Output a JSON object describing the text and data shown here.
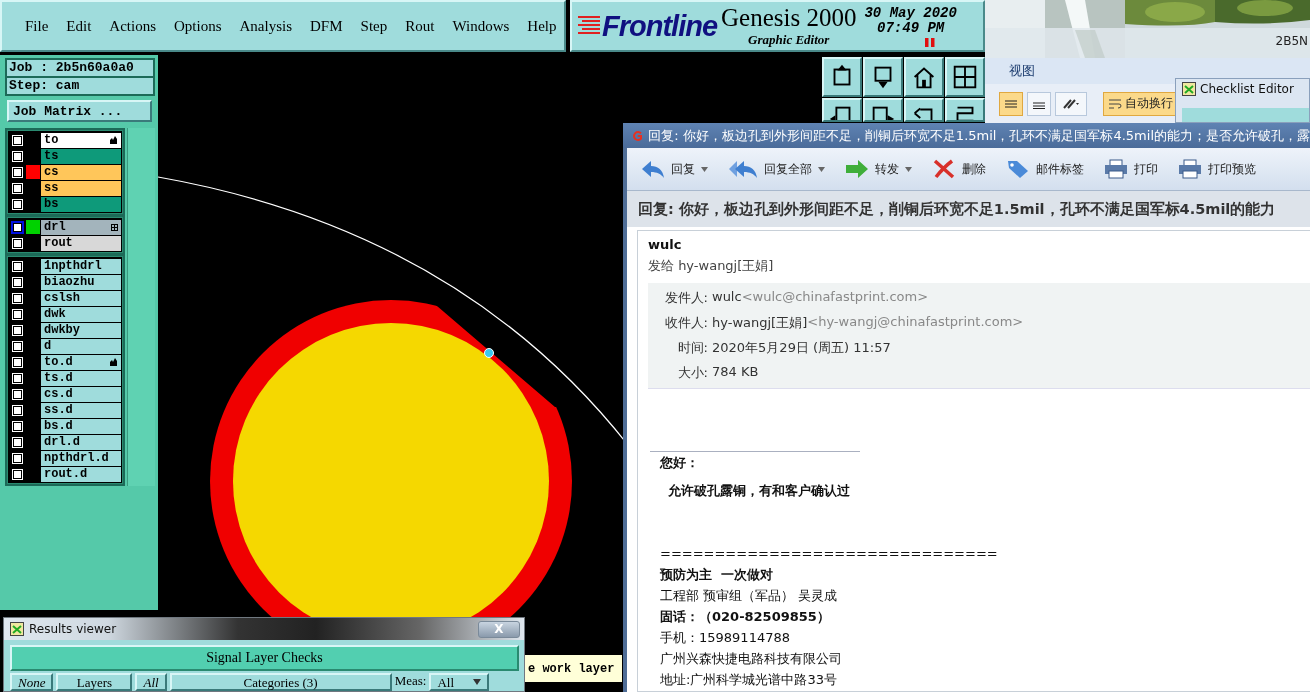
{
  "genesis": {
    "menu": [
      "File",
      "Edit",
      "Actions",
      "Options",
      "Analysis",
      "DFM",
      "Step",
      "Rout",
      "Windows",
      "Help"
    ],
    "logo": {
      "brand": "Frontline",
      "product": "Genesis 2000",
      "subtitle": "Graphic Editor",
      "date": "30 May 2020",
      "time": "07:49 PM"
    },
    "job": "Job : 2b5n60a0a0",
    "step": "Step: cam",
    "job_matrix": "Job Matrix ...",
    "layer_groups": [
      [
        {
          "name": "to",
          "color": "#ffffff",
          "checked": false,
          "selected": false,
          "flag": true
        },
        {
          "name": "ts",
          "color": "#0e9a7a",
          "checked": false,
          "selected": false,
          "flag": false
        },
        {
          "name": "cs",
          "color": "#ffc65a",
          "display": {
            "color": "#ff0000"
          },
          "checked": false,
          "selected": false,
          "flag": false
        },
        {
          "name": "ss",
          "color": "#ffc65a",
          "checked": false,
          "selected": false,
          "flag": false
        },
        {
          "name": "bs",
          "color": "#0e9a7a",
          "checked": false,
          "selected": false,
          "flag": false
        }
      ],
      [
        {
          "name": "drl",
          "color": "#a3b4bc",
          "display": {
            "color": "#00d200"
          },
          "checked": false,
          "selected": true,
          "flag": false
        },
        {
          "name": "rout",
          "color": "#d8d8d8",
          "checked": false,
          "selected": false,
          "flag": false
        }
      ],
      [
        {
          "name": "1npthdrl",
          "color": "#9fdcdc",
          "checked": false,
          "selected": false,
          "flag": false
        },
        {
          "name": "biaozhu",
          "color": "#9fdcdc",
          "checked": false,
          "selected": false,
          "flag": false
        },
        {
          "name": "cslsh",
          "color": "#9fdcdc",
          "checked": false,
          "selected": false,
          "flag": false
        },
        {
          "name": "dwk",
          "color": "#9fdcdc",
          "checked": false,
          "selected": false,
          "flag": false
        },
        {
          "name": "dwkby",
          "color": "#9fdcdc",
          "checked": false,
          "selected": false,
          "flag": false
        },
        {
          "name": "d",
          "color": "#9fdcdc",
          "checked": false,
          "selected": false,
          "flag": false
        },
        {
          "name": "to.d",
          "color": "#9fdcdc",
          "checked": false,
          "selected": false,
          "flag": true
        },
        {
          "name": "ts.d",
          "color": "#9fdcdc",
          "checked": false,
          "selected": false,
          "flag": false
        },
        {
          "name": "cs.d",
          "color": "#9fdcdc",
          "checked": false,
          "selected": false,
          "flag": false
        },
        {
          "name": "ss.d",
          "color": "#9fdcdc",
          "checked": false,
          "selected": false,
          "flag": false
        },
        {
          "name": "bs.d",
          "color": "#9fdcdc",
          "checked": false,
          "selected": false,
          "flag": false
        },
        {
          "name": "drl.d",
          "color": "#9fdcdc",
          "checked": false,
          "selected": false,
          "flag": false
        },
        {
          "name": "npthdrl.d",
          "color": "#9fdcdc",
          "checked": false,
          "selected": false,
          "flag": false
        },
        {
          "name": "rout.d",
          "color": "#9fdcdc",
          "checked": false,
          "selected": false,
          "flag": false
        }
      ]
    ],
    "tooltip": "e work layer"
  },
  "results_viewer": {
    "title": "Results viewer",
    "close": "X",
    "heading": "Signal Layer Checks",
    "controls": [
      {
        "label": "None",
        "kind": "italic"
      },
      {
        "label": "Layers",
        "kind": "wide"
      },
      {
        "label": "All",
        "kind": "italic"
      },
      {
        "label": "Categories (3)",
        "kind": "big"
      },
      {
        "label": "Meas:",
        "kind": "text"
      },
      {
        "label": "All",
        "kind": "dropdown"
      }
    ]
  },
  "background": {
    "window_title": "2B5N",
    "ribbon_tab": "视图",
    "ribbon_button": "自动换行",
    "checklist_title": "Checklist Editor"
  },
  "mail": {
    "title": "回复: 你好，板边孔到外形间距不足，削铜后环宽不足1.5mil，孔环不满足国军标4.5mil的能力；是否允许破孔，露",
    "toolbar": [
      {
        "label": "回复",
        "kind": "reply",
        "dropdown": true
      },
      {
        "label": "回复全部",
        "kind": "reply-all",
        "dropdown": true
      },
      {
        "label": "转发",
        "kind": "forward",
        "dropdown": true
      },
      {
        "label": "删除",
        "kind": "delete",
        "dropdown": false
      },
      {
        "label": "邮件标签",
        "kind": "tag",
        "dropdown": false
      },
      {
        "label": "打印",
        "kind": "print",
        "dropdown": false
      },
      {
        "label": "打印预览",
        "kind": "print",
        "dropdown": false
      }
    ],
    "subject": "回复: 你好，板边孔到外形间距不足，削铜后环宽不足1.5mil，孔环不满足国军标4.5mil的能力",
    "sender": "wulc",
    "recipient_line": "发给 hy-wangj[王娟]",
    "headers": [
      {
        "label": "发件人:",
        "value": "wulc",
        "address": "<wulc@chinafastprint.com>"
      },
      {
        "label": "收件人:",
        "value": "hy-wangj[王娟]",
        "address": "<hy-wangj@chinafastprint.com>"
      },
      {
        "label": "时间:",
        "value": "2020年5月29日 (周五) 11:57"
      },
      {
        "label": "大小:",
        "value": "784 KB"
      }
    ],
    "body": [
      {
        "lines": [
          {
            "text": "您好：",
            "bold": true,
            "indent": false
          },
          {
            "text": "允许破孔露铜，有和客户确认过",
            "bold": true,
            "indent": true
          }
        ]
      },
      {
        "lines": [
          {
            "text": "===============================",
            "bold": false,
            "indent": false
          },
          {
            "text": "预防为主  一次做对",
            "bold": true,
            "indent": false
          },
          {
            "text": "工程部 预审组（军品） 吴灵成",
            "bold": false,
            "indent": false
          },
          {
            "text": "固话：（020-82509855）",
            "bold": true,
            "indent": false
          },
          {
            "text": "手机：15989114788",
            "bold": false,
            "indent": false
          },
          {
            "text": "广州兴森快捷电路科技有限公司",
            "bold": false,
            "indent": false
          },
          {
            "text": "地址:广州科学城光谱中路33号",
            "bold": false,
            "indent": false
          }
        ]
      }
    ]
  }
}
